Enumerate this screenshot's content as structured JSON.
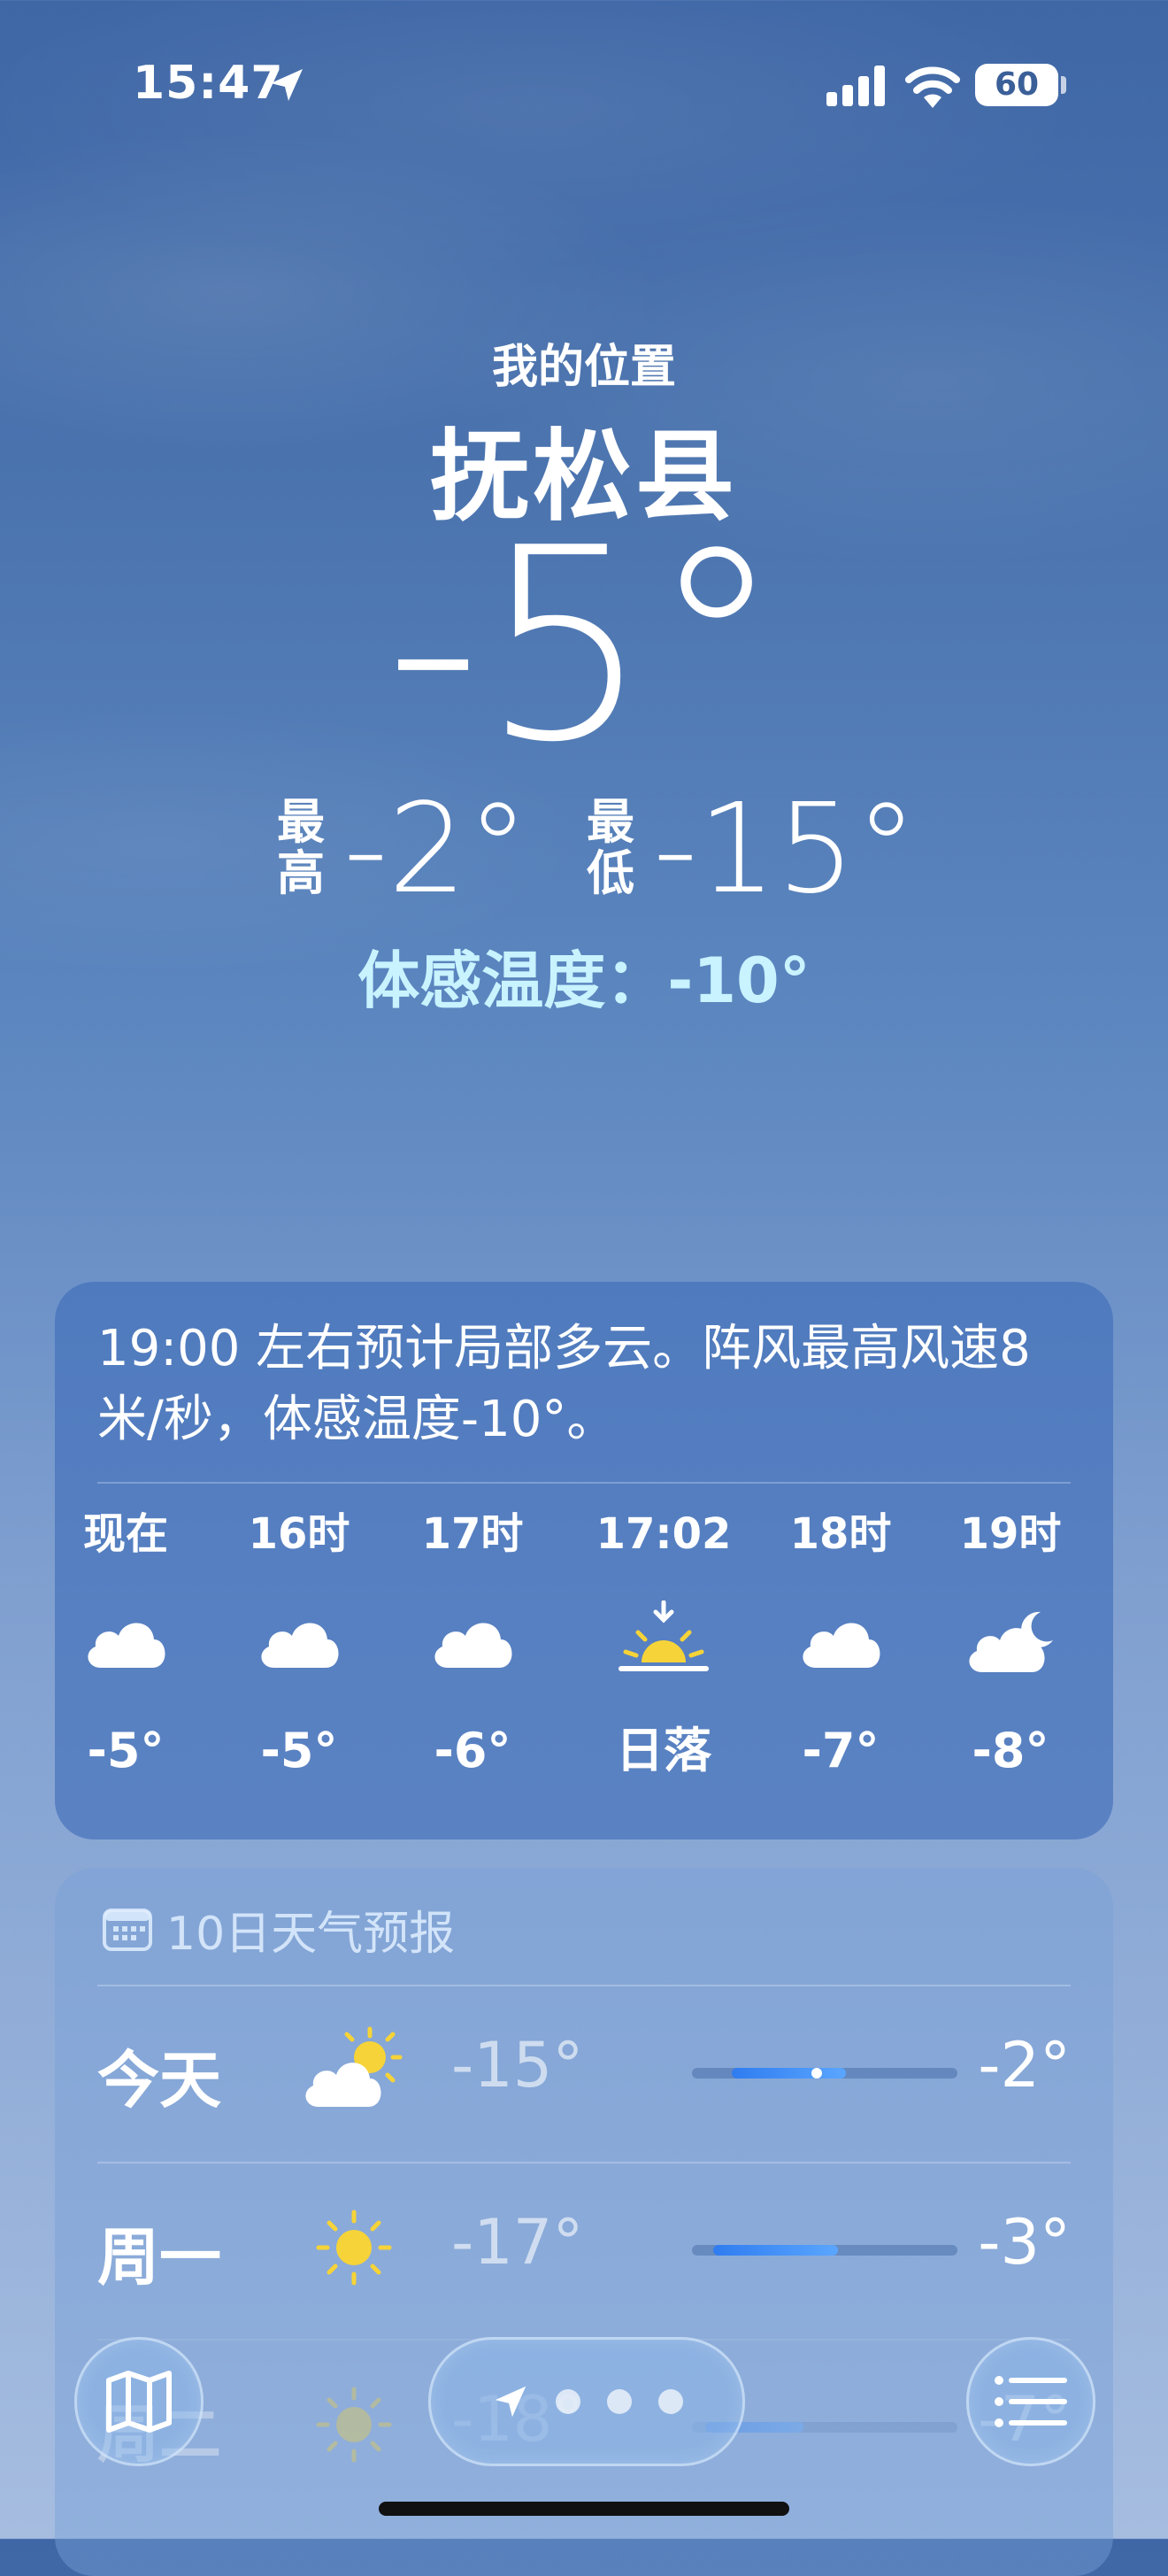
{
  "status_bar": {
    "time": "15:47",
    "battery": "60"
  },
  "header": {
    "subtitle": "我的位置",
    "city": "抚松县",
    "temperature": "-5°",
    "high_label": "最高",
    "high": "-2°",
    "low_label": "最低",
    "low": "-15°",
    "feels_like": "体感温度：-10°"
  },
  "hourly": {
    "description": "19:00 左右预计局部多云。阵风最高风速8 米/秒，体感温度-10°。",
    "items": [
      {
        "label": "现在",
        "icon": "cloud-icon",
        "temp": "-5°"
      },
      {
        "label": "16时",
        "icon": "cloud-icon",
        "temp": "-5°"
      },
      {
        "label": "17时",
        "icon": "cloud-icon",
        "temp": "-6°"
      },
      {
        "label": "17:02",
        "icon": "sunset-icon",
        "temp": "日落"
      },
      {
        "label": "18时",
        "icon": "cloud-icon",
        "temp": "-7°"
      },
      {
        "label": "19时",
        "icon": "cloud-moon-icon",
        "temp": "-8°"
      }
    ]
  },
  "forecast": {
    "title": "10日天气预报",
    "days": [
      {
        "day": "今天",
        "icon": "partly-sunny-icon",
        "low": "-15°",
        "high": "-2°",
        "range_start": 0.15,
        "range_end": 0.58,
        "current": 0.47
      },
      {
        "day": "周一",
        "icon": "sun-icon",
        "low": "-17°",
        "high": "-3°",
        "range_start": 0.08,
        "range_end": 0.55
      },
      {
        "day": "周二",
        "icon": "sun-icon",
        "low": "-18°",
        "high": "-7°",
        "range_start": 0.05,
        "range_end": 0.42
      }
    ]
  },
  "colors": {
    "feels_like": "#c8f3ff",
    "sun": "#f6d338",
    "bar_fill": "#2f7cf0"
  }
}
